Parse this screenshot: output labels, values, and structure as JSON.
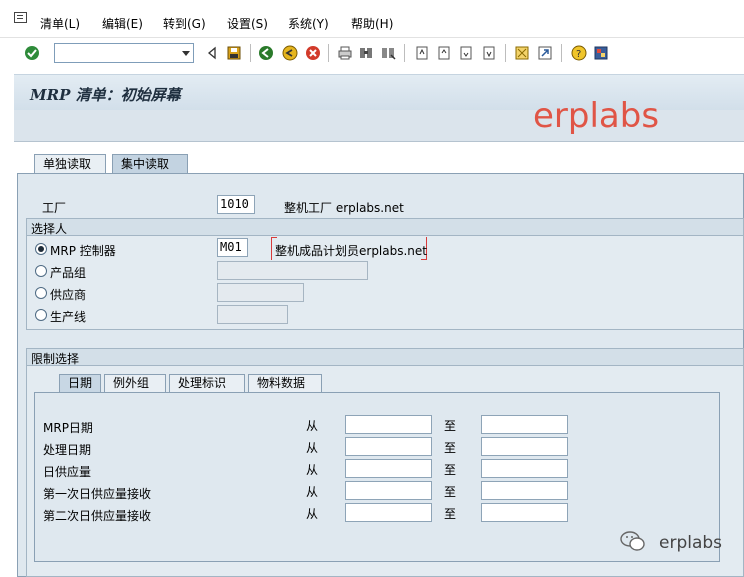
{
  "menu": {
    "items": [
      "清单(L)",
      "编辑(E)",
      "转到(G)",
      "设置(S)",
      "系统(Y)",
      "帮助(H)"
    ]
  },
  "toolbar": {
    "command_field_value": ""
  },
  "screen": {
    "title": "MRP 清单：初始屏幕",
    "watermark": "erplabs"
  },
  "main_tabs": [
    {
      "label": "单独读取",
      "active": false
    },
    {
      "label": "集中读取",
      "active": true
    }
  ],
  "plant": {
    "label": "工厂",
    "value": "1010",
    "description": "整机工厂 erplabs.net"
  },
  "selector_group": {
    "title": "选择人",
    "options": [
      {
        "label": "MRP 控制器",
        "checked": true,
        "value": "M01",
        "description": "整机成品计划员erplabs.net"
      },
      {
        "label": "产品组",
        "checked": false,
        "value": ""
      },
      {
        "label": "供应商",
        "checked": false,
        "value": ""
      },
      {
        "label": "生产线",
        "checked": false,
        "value": ""
      }
    ]
  },
  "restrict_group": {
    "title": "限制选择",
    "tabs": [
      {
        "label": "日期",
        "active": true
      },
      {
        "label": "例外组",
        "active": false
      },
      {
        "label": "处理标识",
        "active": false
      },
      {
        "label": "物料数据",
        "active": false
      }
    ],
    "from_label": "从",
    "to_label": "至",
    "rows": [
      {
        "label": "MRP日期",
        "from": "",
        "to": ""
      },
      {
        "label": "处理日期",
        "from": "",
        "to": ""
      },
      {
        "label": "日供应量",
        "from": "",
        "to": ""
      },
      {
        "label": "第一次日供应量接收",
        "from": "",
        "to": ""
      },
      {
        "label": "第二次日供应量接收",
        "from": "",
        "to": ""
      }
    ]
  },
  "footer_watermark": "erplabs",
  "colors": {
    "watermark": "#e05546",
    "frame_bg": "#dfe8ef",
    "tab_active": "#c3d3e1"
  }
}
